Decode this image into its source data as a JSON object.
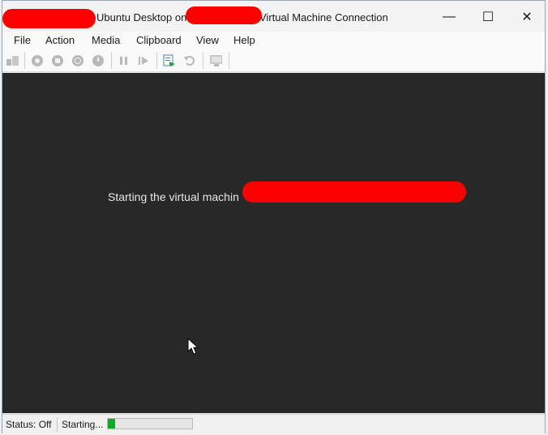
{
  "window": {
    "title_part1": "Ubuntu Desktop on",
    "title_part2": "Virtual Machine Connection",
    "minimize_label": "—",
    "maximize_label": "☐",
    "close_label": "✕"
  },
  "menu": {
    "items": [
      {
        "label": "File"
      },
      {
        "label": "Action"
      },
      {
        "label": "Media"
      },
      {
        "label": "Clipboard"
      },
      {
        "label": "View"
      },
      {
        "label": "Help"
      }
    ]
  },
  "toolbar": {
    "icons": [
      "ctrl-alt-del-icon",
      "start-icon",
      "turn-off-icon",
      "shutdown-icon",
      "power-icon",
      "pause-icon",
      "resume-icon",
      "checkpoint-icon",
      "revert-icon",
      "enhanced-session-icon"
    ]
  },
  "vm": {
    "message": "Starting the virtual machin"
  },
  "status": {
    "state": "Status: Off",
    "activity": "Starting...",
    "progress_fraction": 0.09,
    "progress_color": "#06b025"
  }
}
